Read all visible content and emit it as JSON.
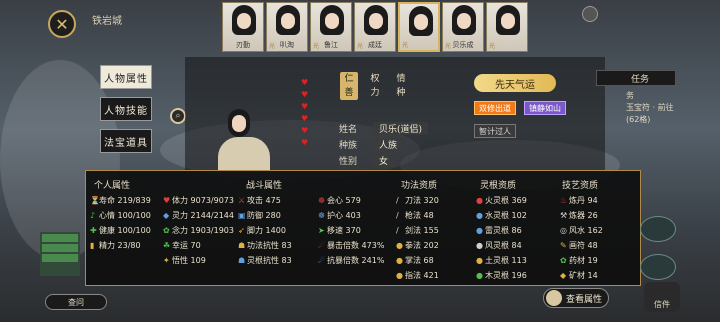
{
  "location": "铁岩城",
  "close_icon": "✕",
  "portraits": [
    {
      "name": "刃勤",
      "tag": "",
      "highlight": false
    },
    {
      "name": "叭淘",
      "tag": "光",
      "highlight": false
    },
    {
      "name": "鲁江",
      "tag": "光",
      "highlight": false
    },
    {
      "name": "成廷",
      "tag": "光",
      "highlight": false
    },
    {
      "name": "",
      "tag": "光",
      "highlight": true
    },
    {
      "name": "贝乐成",
      "tag": "光",
      "highlight": false
    },
    {
      "name": "",
      "tag": "光",
      "highlight": false
    }
  ],
  "side_tabs": [
    {
      "label": "人物属性",
      "active": true
    },
    {
      "label": "人物技能",
      "active": false
    },
    {
      "label": "法宝道具",
      "active": false
    }
  ],
  "traits": [
    {
      "top": "仁",
      "bottom": "善",
      "highlight": true
    },
    {
      "top": "权",
      "bottom": "力",
      "highlight": false
    },
    {
      "top": "情",
      "bottom": "种",
      "highlight": false
    }
  ],
  "identity": [
    {
      "key": "姓名",
      "value": "贝乐(道侣)"
    },
    {
      "key": "种族",
      "value": "人族"
    },
    {
      "key": "性别",
      "value": "女"
    }
  ],
  "xiantian_label": "先天气运",
  "fortune_tags": [
    {
      "label": "双修出道",
      "style": "o"
    },
    {
      "label": "镇静如山",
      "style": "p"
    }
  ],
  "fortune_tag_gray": "智计过人",
  "right_panel": {
    "title": "任务",
    "lines": [
      "务",
      "玉宝符 · 前往",
      "(62格)"
    ]
  },
  "stat_panel": {
    "columns": [
      {
        "title": "个人属性"
      },
      {
        "title": "战斗属性"
      },
      {
        "title": "功法资质"
      },
      {
        "title": "灵根资质"
      },
      {
        "title": "技艺资质"
      }
    ],
    "personal": [
      {
        "label": "寿命",
        "value": "219/839",
        "icon": "⏳",
        "color": "y"
      },
      {
        "label": "心情",
        "value": "100/100",
        "icon": "♪",
        "color": "g"
      },
      {
        "label": "健康",
        "value": "100/100",
        "icon": "✚",
        "color": "g"
      },
      {
        "label": "精力",
        "value": "23/80",
        "icon": "▮",
        "color": "y"
      }
    ],
    "combat_left": [
      {
        "label": "体力",
        "value": "9073/9073",
        "icon": "♥",
        "color": "r"
      },
      {
        "label": "灵力",
        "value": "2144/2144",
        "icon": "◆",
        "color": "b"
      },
      {
        "label": "念力",
        "value": "1903/1903",
        "icon": "✿",
        "color": "g"
      },
      {
        "label": "幸运",
        "value": "70",
        "icon": "☘",
        "color": "g"
      },
      {
        "label": "悟性",
        "value": "109",
        "icon": "✦",
        "color": "y"
      }
    ],
    "combat_mid": [
      {
        "label": "攻击",
        "value": "475",
        "icon": "⚔",
        "color": "r"
      },
      {
        "label": "防御",
        "value": "280",
        "icon": "▣",
        "color": "b"
      },
      {
        "label": "脚力",
        "value": "1400",
        "icon": "➶",
        "color": "y"
      },
      {
        "label": "功法抗性",
        "value": "83",
        "icon": "☗",
        "color": "y"
      },
      {
        "label": "灵根抗性",
        "value": "83",
        "icon": "☗",
        "color": "b"
      }
    ],
    "combat_right": [
      {
        "label": "会心",
        "value": "579",
        "icon": "☸",
        "color": "r"
      },
      {
        "label": "护心",
        "value": "403",
        "icon": "☸",
        "color": "b"
      },
      {
        "label": "移速",
        "value": "370",
        "icon": "➤",
        "color": "g"
      },
      {
        "label": "暴击倍数",
        "value": "473%",
        "icon": "☄",
        "color": "r"
      },
      {
        "label": "抗暴倍数",
        "value": "241%",
        "icon": "☄",
        "color": "b"
      }
    ],
    "gongfa": [
      {
        "label": "刀法",
        "value": "320",
        "icon": "/",
        "color": "w"
      },
      {
        "label": "枪法",
        "value": "48",
        "icon": "/",
        "color": "w"
      },
      {
        "label": "剑法",
        "value": "155",
        "icon": "/",
        "color": "w"
      },
      {
        "label": "拳法",
        "value": "202",
        "icon": "●",
        "color": "y"
      },
      {
        "label": "掌法",
        "value": "68",
        "icon": "●",
        "color": "y"
      },
      {
        "label": "指法",
        "value": "421",
        "icon": "●",
        "color": "y"
      }
    ],
    "linggen": [
      {
        "label": "火灵根",
        "value": "369",
        "icon": "●",
        "color": "r"
      },
      {
        "label": "水灵根",
        "value": "102",
        "icon": "●",
        "color": "b"
      },
      {
        "label": "雷灵根",
        "value": "86",
        "icon": "●",
        "color": "b"
      },
      {
        "label": "风灵根",
        "value": "84",
        "icon": "●",
        "color": "w"
      },
      {
        "label": "土灵根",
        "value": "113",
        "icon": "●",
        "color": "y"
      },
      {
        "label": "木灵根",
        "value": "196",
        "icon": "●",
        "color": "g"
      }
    ],
    "jiyi": [
      {
        "label": "炼丹",
        "value": "94",
        "icon": "♨",
        "color": "r"
      },
      {
        "label": "炼器",
        "value": "26",
        "icon": "⚒",
        "color": "w"
      },
      {
        "label": "风水",
        "value": "162",
        "icon": "◎",
        "color": "w"
      },
      {
        "label": "画符",
        "value": "48",
        "icon": "✎",
        "color": "y"
      },
      {
        "label": "药材",
        "value": "19",
        "icon": "✿",
        "color": "g"
      },
      {
        "label": "矿材",
        "value": "14",
        "icon": "◆",
        "color": "y"
      }
    ]
  },
  "view_button": "查看属性",
  "bottom_left": "查问",
  "credit": "信件"
}
